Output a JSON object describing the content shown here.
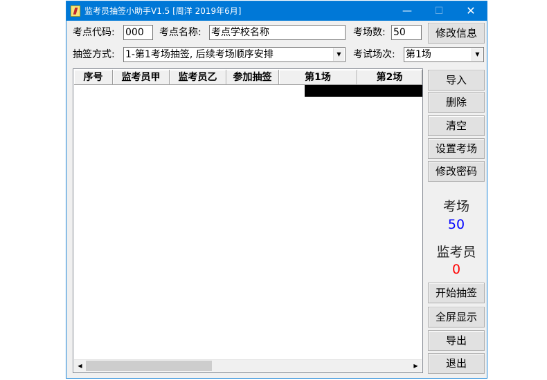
{
  "window": {
    "title": "监考员抽签小助手V1.5 [周洋 2019年6月]",
    "minimize_glyph": "—",
    "maximize_glyph": "☐",
    "close_glyph": "✕"
  },
  "form": {
    "site_code_label": "考点代码:",
    "site_code_value": "000",
    "site_name_label": "考点名称:",
    "site_name_value": "考点学校名称",
    "room_count_label": "考场数:",
    "room_count_value": "50",
    "modify_info_label": "修改信息",
    "draw_method_label": "抽签方式:",
    "draw_method_value": "1-第1考场抽签, 后续考场顺序安排",
    "session_label": "考试场次:",
    "session_value": "第1场"
  },
  "grid": {
    "columns": [
      "序号",
      "监考员甲",
      "监考员乙",
      "参加抽签",
      "第1场",
      "第2场"
    ],
    "rows": []
  },
  "side": {
    "import_label": "导入",
    "delete_label": "删除",
    "clear_label": "清空",
    "set_rooms_label": "设置考场",
    "change_password_label": "修改密码",
    "rooms_stat_label": "考场",
    "rooms_stat_value": "50",
    "invigilators_stat_label": "监考员",
    "invigilators_stat_value": "0",
    "start_draw_label": "开始抽签",
    "fullscreen_label": "全屏显示",
    "export_label": "导出",
    "exit_label": "退出"
  },
  "colors": {
    "titlebar": "#0078d7",
    "rooms_value": "#0000ff",
    "invigilators_value": "#ff0000"
  }
}
